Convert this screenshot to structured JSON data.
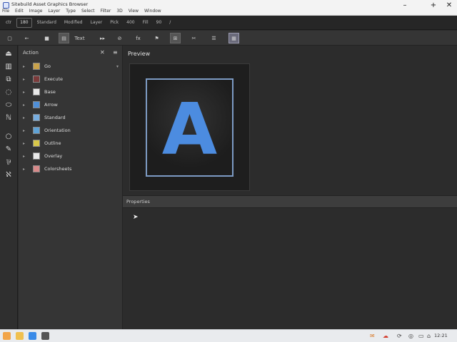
{
  "window": {
    "title_left": "Sitebuild Asset",
    "title_right": "Graphics Browser",
    "menu": [
      "File",
      "Edit",
      "Image",
      "Layer",
      "Type",
      "Select",
      "Filter",
      "3D",
      "View",
      "Window"
    ]
  },
  "window_controls": {
    "minimize": "–",
    "maximize": "+",
    "close": "✕"
  },
  "toolbar": {
    "items": [
      {
        "label": "ctr",
        "boxed": false
      },
      {
        "label": "180",
        "boxed": true
      },
      {
        "label": "Standard",
        "boxed": false
      },
      {
        "label": "Modified",
        "boxed": false
      },
      {
        "label": "Layer",
        "boxed": false
      },
      {
        "label": "Pick",
        "boxed": false
      },
      {
        "label": "400",
        "boxed": false
      },
      {
        "label": "Fill",
        "boxed": false
      },
      {
        "label": "90",
        "boxed": false
      },
      {
        "label": "/",
        "boxed": false
      }
    ]
  },
  "toolbar2": {
    "items": [
      {
        "icon": "square-icon",
        "glyph": "▢"
      },
      {
        "icon": "back-arrow-icon",
        "glyph": "←"
      },
      {
        "icon": "stop-icon",
        "glyph": "■"
      },
      {
        "icon": "grid-icon",
        "glyph": "▤"
      },
      {
        "icon": "text-icon",
        "glyph": "Text"
      },
      {
        "icon": "play-icon",
        "glyph": "▸▸"
      },
      {
        "icon": "link-icon",
        "glyph": "⊘"
      },
      {
        "icon": "fx-icon",
        "glyph": "fx"
      },
      {
        "icon": "flag-icon",
        "glyph": "⚑"
      },
      {
        "icon": "box-select-icon",
        "glyph": "⊞"
      },
      {
        "icon": "scissors-icon",
        "glyph": "✂"
      },
      {
        "icon": "lines-icon",
        "glyph": "☰"
      },
      {
        "icon": "panel-icon",
        "glyph": "▦"
      }
    ]
  },
  "left_tools": [
    {
      "icon": "pointer-icon",
      "glyph": "⏏"
    },
    {
      "icon": "book-icon",
      "glyph": "▥"
    },
    {
      "icon": "frame-icon",
      "glyph": "⧉"
    },
    {
      "icon": "lasso-icon",
      "glyph": "◌"
    },
    {
      "icon": "bucket-icon",
      "glyph": "⬭"
    },
    {
      "icon": "pen-icon",
      "glyph": "ℕ"
    },
    {
      "icon": "ellipse-icon",
      "glyph": "○"
    },
    {
      "icon": "brush-icon",
      "glyph": "✎"
    },
    {
      "icon": "eyedropper-icon",
      "glyph": "⅌"
    },
    {
      "icon": "transform-icon",
      "glyph": "ℵ"
    }
  ],
  "actions_panel": {
    "title": "Action",
    "close_glyph": "✕",
    "menu_glyph": "≡",
    "rows": [
      {
        "arrow": "▸",
        "label": "Go",
        "swatch": "#c9a24a",
        "dropdown": "▾"
      },
      {
        "arrow": "▸",
        "label": "Execute",
        "swatch": "#7a3a3a"
      },
      {
        "arrow": "▸",
        "label": "Base",
        "swatch": "#e8e8e8"
      },
      {
        "arrow": "▸",
        "label": "Arrow",
        "swatch": "#4f8fd8"
      },
      {
        "arrow": "▸",
        "label": "Standard",
        "swatch": "#78aee0"
      },
      {
        "arrow": "▸",
        "label": "Orientation",
        "swatch": "#5fa2d6"
      },
      {
        "arrow": "▸",
        "label": "Outline",
        "swatch": "#d8c84a"
      },
      {
        "arrow": "▸",
        "label": "Overlay",
        "swatch": "#e8e8e8"
      },
      {
        "arrow": "▸",
        "label": "Colorsheets",
        "swatch": "#d88a8a"
      }
    ]
  },
  "main": {
    "preview_title": "Preview",
    "preview_letter": "A",
    "section_label": "Properties"
  },
  "taskbar": {
    "time": "12:21",
    "apps": [
      {
        "icon": "start-icon",
        "color": "#f2a54a"
      },
      {
        "icon": "files-icon",
        "color": "#f0c050"
      },
      {
        "icon": "browser-icon",
        "color": "#3a8be8"
      },
      {
        "icon": "app-icon",
        "color": "#555"
      }
    ],
    "tray": [
      {
        "icon": "chat-icon",
        "glyph": "✉",
        "color": "#d97a2a"
      },
      {
        "icon": "cloud-icon",
        "glyph": "☁",
        "color": "#d33a2a"
      },
      {
        "icon": "sync-icon",
        "glyph": "⟳",
        "color": "#444"
      },
      {
        "icon": "network-icon",
        "glyph": "◎",
        "color": "#444"
      },
      {
        "icon": "volume-icon",
        "glyph": "▭",
        "color": "#444"
      },
      {
        "icon": "wifi-icon",
        "glyph": "⌂",
        "color": "#444"
      },
      {
        "icon": "notification-icon",
        "glyph": "▭",
        "color": "#444"
      }
    ]
  }
}
